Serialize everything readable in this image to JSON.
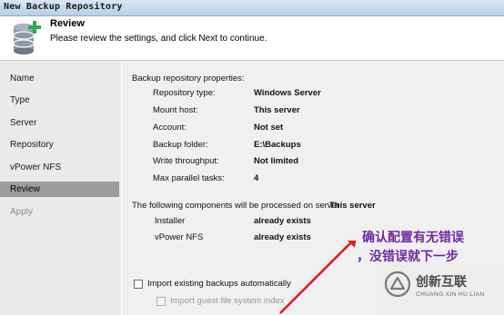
{
  "window": {
    "title": "New Backup Repository"
  },
  "header": {
    "icon": "database-add-icon",
    "title": "Review",
    "subtitle": "Please review the settings, and click Next to continue."
  },
  "sidebar": {
    "items": [
      {
        "label": "Name",
        "state": "normal"
      },
      {
        "label": "Type",
        "state": "normal"
      },
      {
        "label": "Server",
        "state": "normal"
      },
      {
        "label": "Repository",
        "state": "normal"
      },
      {
        "label": "vPower NFS",
        "state": "normal"
      },
      {
        "label": "Review",
        "state": "selected"
      },
      {
        "label": "Apply",
        "state": "disabled"
      }
    ]
  },
  "main": {
    "properties_heading": "Backup repository properties:",
    "properties": [
      {
        "label": "Repository type:",
        "value": "Windows Server"
      },
      {
        "label": "Mount host:",
        "value": "This server"
      },
      {
        "label": "Account:",
        "value": "Not set"
      },
      {
        "label": "Backup folder:",
        "value": "E:\\Backups"
      },
      {
        "label": "Write throughput:",
        "value": "Not limited"
      },
      {
        "label": "Max parallel tasks:",
        "value": "4"
      }
    ],
    "components_heading": "The following components will be processed on server",
    "components_server": "This server",
    "components": [
      {
        "name": "Installer",
        "status": "already exists"
      },
      {
        "name": "vPower NFS",
        "status": "already exists"
      }
    ],
    "import_backups_label": "Import existing backups automatically",
    "import_backups_checked": false,
    "import_index_label": "Import guest file system index",
    "import_index_checked": false,
    "import_index_enabled": false
  },
  "annotation": {
    "line1": "确认配置有无错误",
    "line2": "，没错误就下一步",
    "color": "#6f2a9e",
    "arrow_color": "#e0201c"
  },
  "watermark": {
    "name": "创新互联",
    "subtitle": "CHUANG XIN HU LIAN"
  }
}
